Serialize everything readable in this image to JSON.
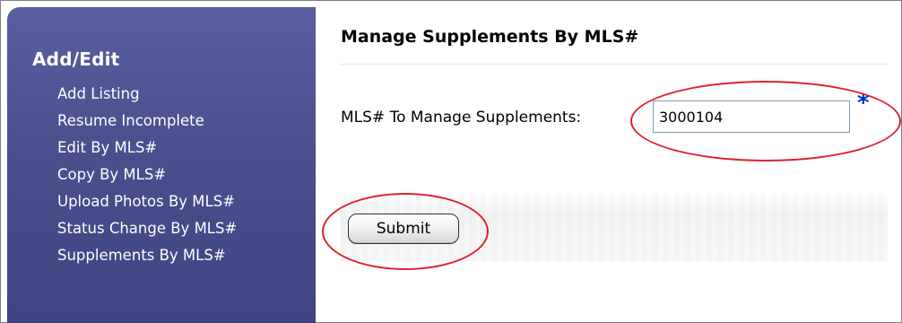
{
  "sidebar": {
    "title": "Add/Edit",
    "items": [
      {
        "label": "Add Listing"
      },
      {
        "label": "Resume Incomplete"
      },
      {
        "label": "Edit By MLS#"
      },
      {
        "label": "Copy By MLS#"
      },
      {
        "label": "Upload Photos By MLS#"
      },
      {
        "label": "Status Change By MLS#"
      },
      {
        "label": "Supplements By MLS#"
      }
    ],
    "background_color": "#4a4f8e"
  },
  "main": {
    "title": "Manage Supplements By MLS#",
    "form": {
      "label": "MLS# To Manage Supplements:",
      "input_value": "3000104",
      "required_marker": "*"
    },
    "submit_label": "Submit"
  },
  "annotations": {
    "highlight_color": "#e0202a"
  }
}
